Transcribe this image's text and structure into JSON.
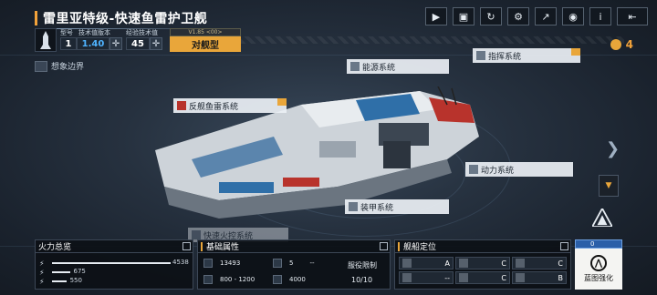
{
  "header": {
    "title": "雷里亚特级-快速鱼雷护卫舰",
    "model_label": "型号",
    "model_value": "1",
    "tech_version_label": "技术值版本",
    "tech_version_value": "1.40",
    "exp_label": "经验技术值",
    "exp_value": "45",
    "type_version": "V1.85 <00>",
    "ship_type": "对舰型",
    "currency_value": "4"
  },
  "toolbar": {
    "icons": [
      "video-icon",
      "gallery-icon",
      "refresh-icon",
      "settings-icon",
      "share-icon",
      "view-icon",
      "info-icon",
      "back-icon"
    ],
    "glyphs": [
      "▶",
      "▣",
      "↻",
      "⚙",
      "↗",
      "◉",
      "i",
      "⇤"
    ]
  },
  "boundary_label": "想象边界",
  "systems": {
    "energy": "能源系统",
    "command": "指挥系统",
    "torpedo": "反舰鱼雷系统",
    "power": "动力系统",
    "armor": "装甲系统",
    "firecontrol": "快速火控系统"
  },
  "firepower": {
    "title": "火力总览",
    "rows": [
      {
        "value": "4538",
        "fraction": 1.0
      },
      {
        "value": "675",
        "fraction": 0.15
      },
      {
        "value": "550",
        "fraction": 0.12
      }
    ]
  },
  "attributes": {
    "title": "基础属性",
    "hp": "13493",
    "slots": "5",
    "slots_extra": "--",
    "range": "800 - 1200",
    "cost": "4000",
    "service_limit_label": "服役限制",
    "service_limit_value": "10/10"
  },
  "positioning": {
    "title": "舰船定位",
    "cells": [
      "A",
      "C",
      "C",
      "--",
      "C",
      "B"
    ]
  },
  "blueprint": {
    "top_value": "0",
    "label": "蓝图强化"
  },
  "colors": {
    "accent": "#e9a63a",
    "blue": "#4fb3ff"
  }
}
